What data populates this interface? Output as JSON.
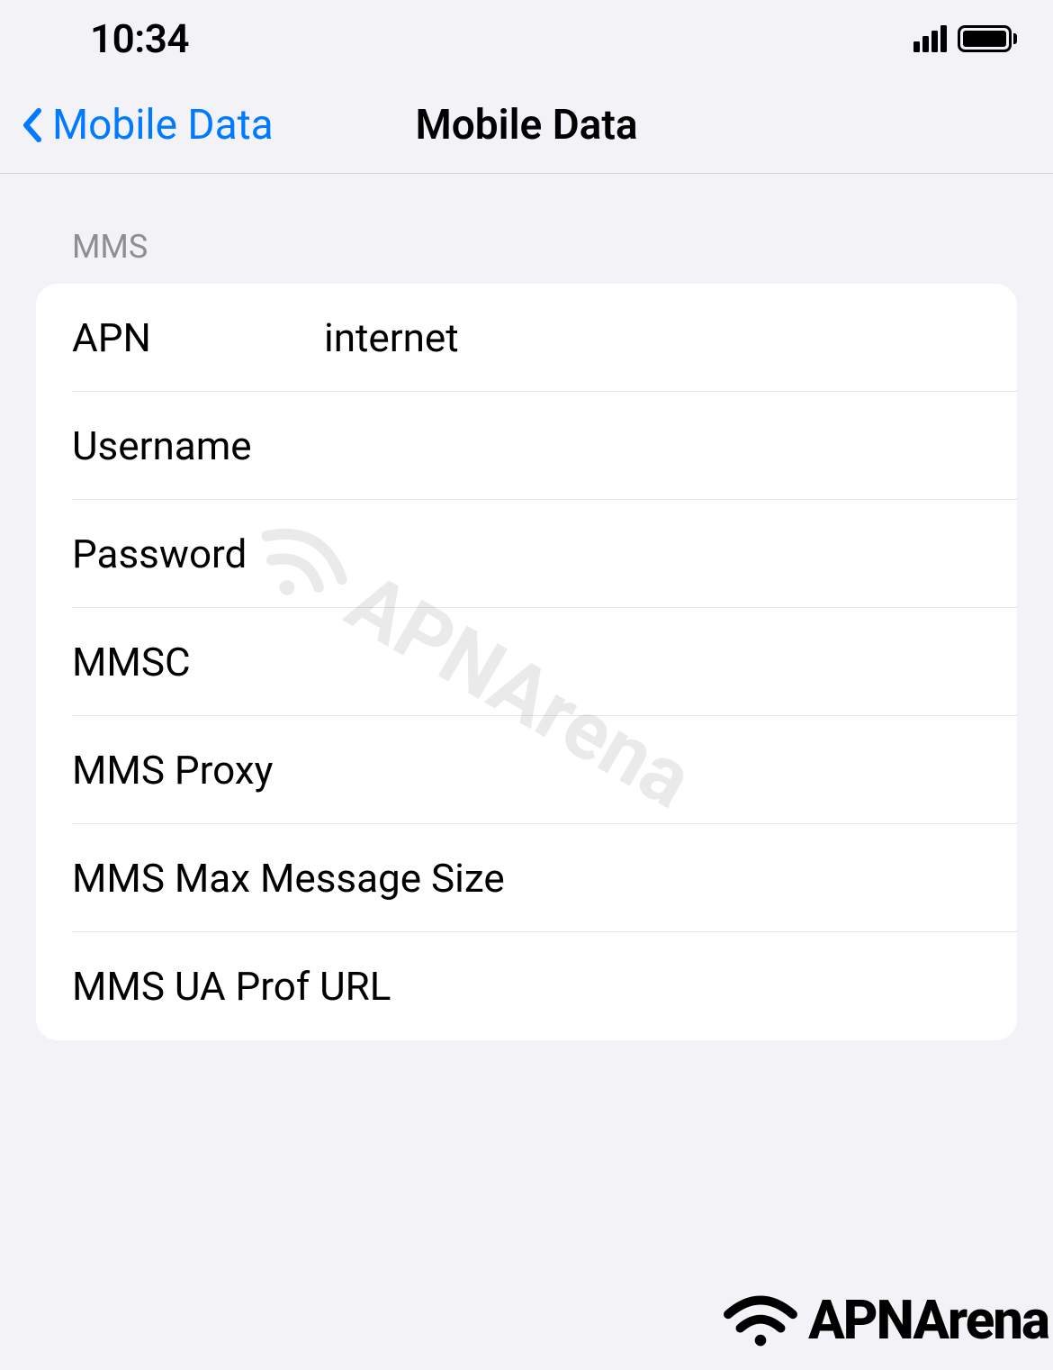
{
  "statusBar": {
    "time": "10:34"
  },
  "navBar": {
    "backLabel": "Mobile Data",
    "title": "Mobile Data"
  },
  "section": {
    "header": "MMS"
  },
  "fields": {
    "apn": {
      "label": "APN",
      "value": "internet"
    },
    "username": {
      "label": "Username",
      "value": ""
    },
    "password": {
      "label": "Password",
      "value": ""
    },
    "mmsc": {
      "label": "MMSC",
      "value": ""
    },
    "mmsProxy": {
      "label": "MMS Proxy",
      "value": ""
    },
    "mmsMaxSize": {
      "label": "MMS Max Message Size",
      "value": ""
    },
    "mmsUaProf": {
      "label": "MMS UA Prof URL",
      "value": ""
    }
  },
  "watermark": {
    "text": "APNArena"
  },
  "footer": {
    "brand": "APNArena"
  }
}
